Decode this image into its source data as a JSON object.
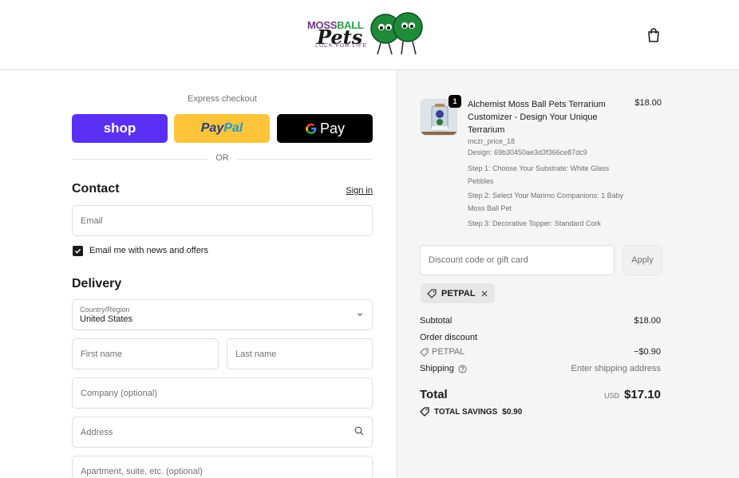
{
  "header": {
    "logo_top_a": "MOSS",
    "logo_top_b": "BALL",
    "logo_main": "Pets",
    "logo_tagline": "LUCK FOR LIFE",
    "cart_icon": "shopping-bag-icon"
  },
  "express": {
    "title": "Express checkout",
    "shop_label": "shop",
    "paypal_a": "Pay",
    "paypal_b": "Pal",
    "gpay_label": "Pay",
    "or_label": "OR"
  },
  "contact": {
    "heading": "Contact",
    "sign_in": "Sign in",
    "email_placeholder": "Email",
    "newsletter_label": "Email me with news and offers",
    "newsletter_checked": true
  },
  "delivery": {
    "heading": "Delivery",
    "country_label": "Country/Region",
    "country_value": "United States",
    "first_name": "First name",
    "last_name": "Last name",
    "company": "Company (optional)",
    "address": "Address",
    "apartment": "Apartment, suite, etc. (optional)"
  },
  "order": {
    "quantity": "1",
    "product_name": "Alchemist Moss Ball Pets Terrarium Customizer - Design Your Unique Terrarium",
    "product_price": "$18.00",
    "sku": "mczr_price_18",
    "design": "Design: 69b30450ae3d3f366ce87dc9",
    "step1": "Step 1: Choose Your Substrate: White Glass Pebbles",
    "step2": "Step 2: Select Your Marimo Companions: 1 Baby Moss Ball Pet",
    "step3": "Step 3: Decorative Topper: Standard Cork"
  },
  "discount": {
    "placeholder": "Discount code or gift card",
    "apply_label": "Apply",
    "applied_code": "PETPAL"
  },
  "summary": {
    "subtotal_label": "Subtotal",
    "subtotal_value": "$18.00",
    "order_discount_label": "Order discount",
    "discount_code": "PETPAL",
    "discount_value": "−$0.90",
    "shipping_label": "Shipping",
    "shipping_value": "Enter shipping address",
    "total_label": "Total",
    "currency": "USD",
    "total_value": "$17.10",
    "savings_label": "TOTAL SAVINGS",
    "savings_value": "$0.90"
  },
  "colors": {
    "shop_purple": "#5a31f4",
    "paypal_yellow": "#ffc439",
    "gpay_black": "#000000",
    "panel_gray": "#f5f5f5"
  }
}
